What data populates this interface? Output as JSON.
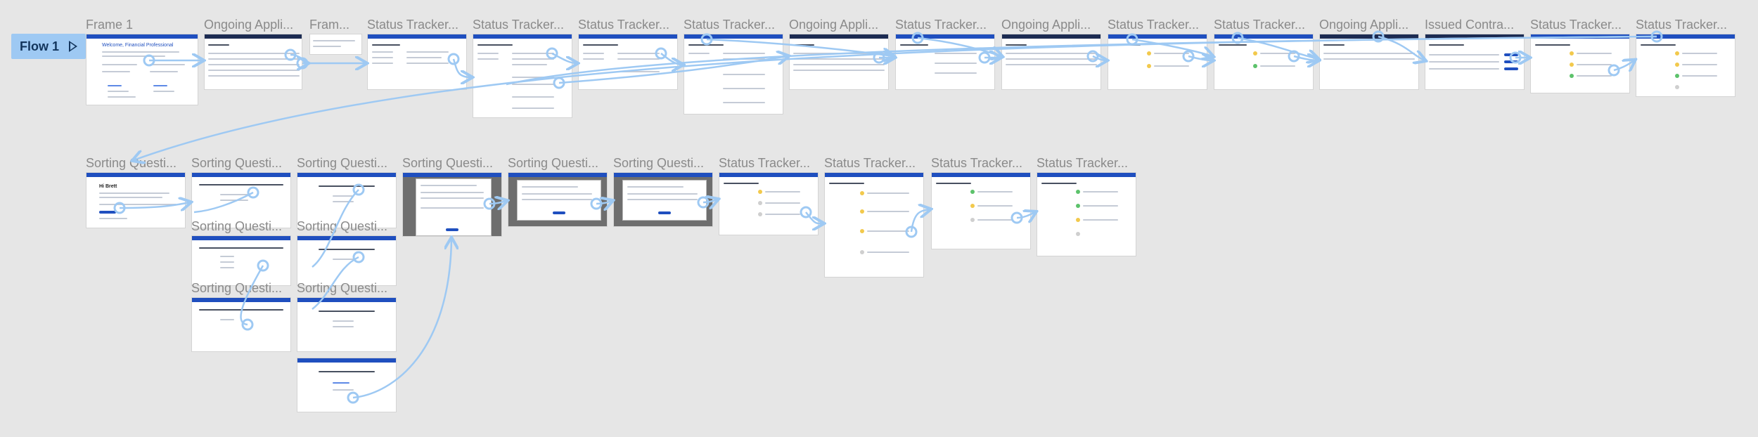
{
  "flow": {
    "label": "Flow 1"
  },
  "frames": [
    {
      "id": "f1",
      "title": "Frame 1",
      "variant": "welcome",
      "heading": "Welcome, Financial Professional"
    },
    {
      "id": "f2",
      "title": "Ongoing Appli...",
      "variant": "table"
    },
    {
      "id": "f3",
      "title": "Fram...",
      "variant": "tiny"
    },
    {
      "id": "f4",
      "title": "Status Tracker...",
      "variant": "tracker"
    },
    {
      "id": "f5",
      "title": "Status Tracker...",
      "variant": "tracker-tall"
    },
    {
      "id": "f6",
      "title": "Status Tracker...",
      "variant": "tracker"
    },
    {
      "id": "f7",
      "title": "Status Tracker...",
      "variant": "tracker-tall"
    },
    {
      "id": "f8",
      "title": "Ongoing Appli...",
      "variant": "table"
    },
    {
      "id": "f9",
      "title": "Status Tracker...",
      "variant": "tracker-list"
    },
    {
      "id": "f10",
      "title": "Ongoing Appli...",
      "variant": "table"
    },
    {
      "id": "f11",
      "title": "Status Tracker...",
      "variant": "tracker-list"
    },
    {
      "id": "f12",
      "title": "Status Tracker...",
      "variant": "tracker-list"
    },
    {
      "id": "f13",
      "title": "Ongoing Appli...",
      "variant": "table"
    },
    {
      "id": "f14",
      "title": "Issued Contra...",
      "variant": "table-badges"
    },
    {
      "id": "f15",
      "title": "Status Tracker...",
      "variant": "tracker-status"
    },
    {
      "id": "f16",
      "title": "Status Tracker...",
      "variant": "tracker-status"
    },
    {
      "id": "s1",
      "title": "Sorting Questi...",
      "variant": "intro",
      "heading": "Hi Brett"
    },
    {
      "id": "s2",
      "title": "Sorting Questi...",
      "variant": "question"
    },
    {
      "id": "s3",
      "title": "Sorting Questi...",
      "variant": "question"
    },
    {
      "id": "s4",
      "title": "Sorting Questi...",
      "variant": "question"
    },
    {
      "id": "s5",
      "title": "Sorting Questi...",
      "variant": "question"
    },
    {
      "id": "s6",
      "title": "Sorting Questi...",
      "variant": "question"
    },
    {
      "id": "s7",
      "title": "Sorting Questi...",
      "variant": "question"
    },
    {
      "id": "s8",
      "title": "Sorting Questi...",
      "variant": "modal"
    },
    {
      "id": "s9",
      "title": "Sorting Questi...",
      "variant": "modal"
    },
    {
      "id": "s10",
      "title": "Sorting Questi...",
      "variant": "modal"
    },
    {
      "id": "t1",
      "title": "Status Tracker...",
      "variant": "tracker-status"
    },
    {
      "id": "t2",
      "title": "Status Tracker...",
      "variant": "tracker-tall"
    },
    {
      "id": "t3",
      "title": "Status Tracker...",
      "variant": "tracker-status"
    },
    {
      "id": "t4",
      "title": "Status Tracker...",
      "variant": "tracker-status"
    }
  ],
  "colors": {
    "canvas": "#e6e6e6",
    "connector": "#9ec9f3",
    "brand": "#1f4fbf",
    "flowBadge": "#9ec9f3"
  }
}
